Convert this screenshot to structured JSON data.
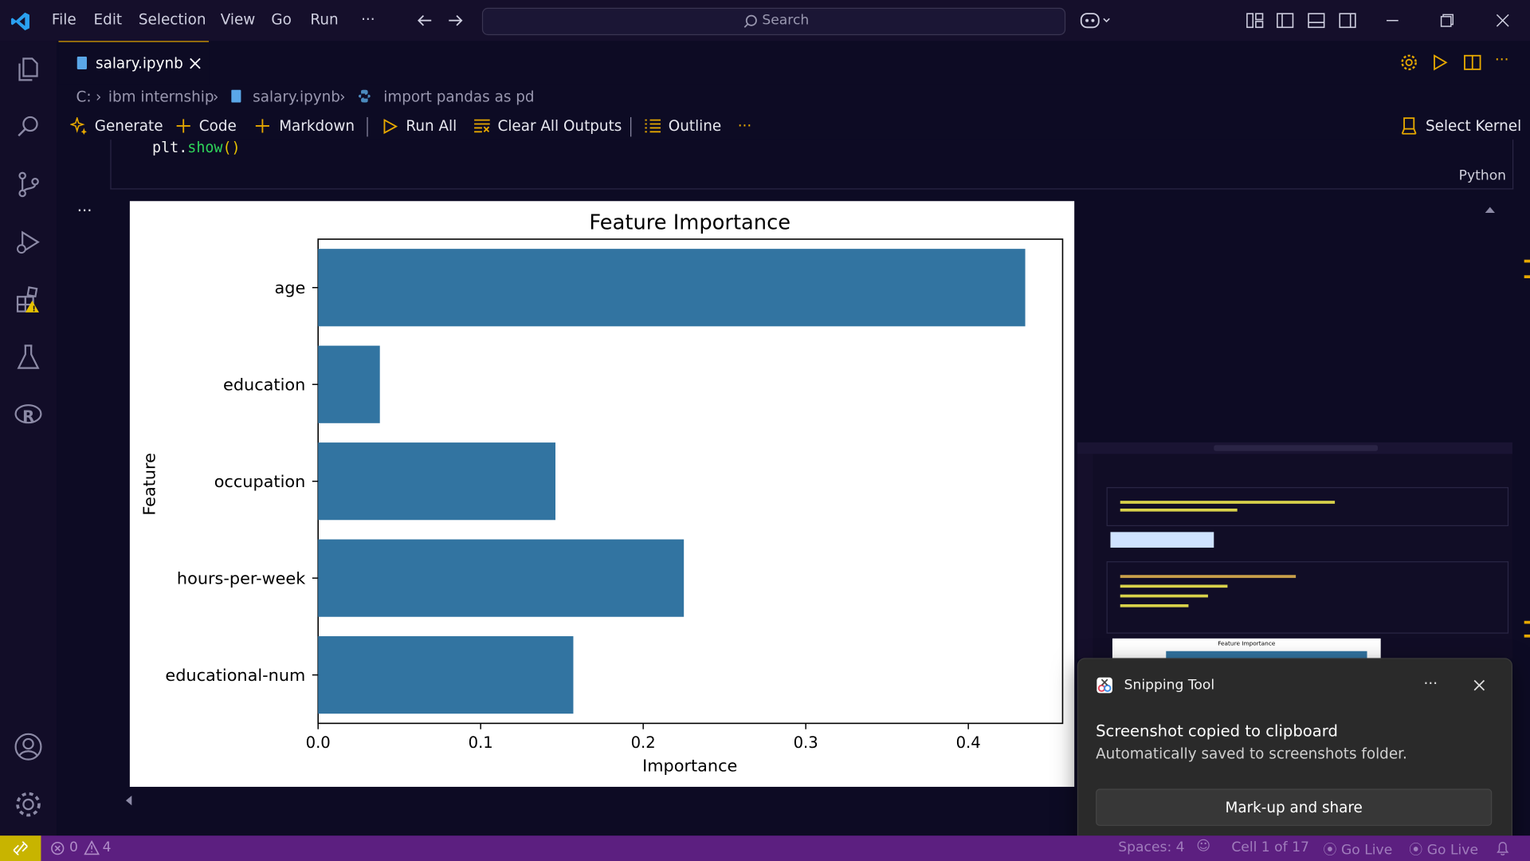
{
  "menu": [
    "File",
    "Edit",
    "Selection",
    "View",
    "Go",
    "Run",
    "···"
  ],
  "search": {
    "placeholder": "Search"
  },
  "tab": {
    "name": "salary.ipynb"
  },
  "breadcrumb": [
    "C:",
    "ibm internship",
    "salary.ipynb",
    "import pandas as pd"
  ],
  "toolbar": {
    "generate": "Generate",
    "code": "Code",
    "markdown": "Markdown",
    "run_all": "Run All",
    "clear_outputs": "Clear All Outputs",
    "outline": "Outline",
    "more": "···",
    "select_kernel": "Select Kernel"
  },
  "cell": {
    "code_obj": "plt",
    "code_fn": "show",
    "code_paren": "()",
    "language": "Python"
  },
  "chart_data": {
    "type": "bar",
    "orientation": "horizontal",
    "title": "Feature Importance",
    "xlabel": "Importance",
    "ylabel": "Feature",
    "categories": [
      "age",
      "education",
      "occupation",
      "hours-per-week",
      "educational-num"
    ],
    "values": [
      0.435,
      0.038,
      0.146,
      0.225,
      0.157
    ],
    "xlim": [
      0,
      0.458
    ],
    "xticks": [
      "0.0",
      "0.1",
      "0.2",
      "0.3",
      "0.4"
    ],
    "color": "#3274a1",
    "grid": false
  },
  "toast": {
    "app": "Snipping Tool",
    "title": "Screenshot copied to clipboard",
    "body": "Automatically saved to screenshots folder.",
    "button": "Mark-up and share"
  },
  "thumb_title": "Feature Importance",
  "status": {
    "errors": "0",
    "warnings": "4",
    "spaces": "Spaces: 4",
    "cell": "Cell 1 of 17",
    "golive": "Go Live"
  },
  "colors": {
    "accent": "#e6a800",
    "statusbar": "#5c1f80",
    "remote": "#c8b400",
    "bar": "#3274a1"
  }
}
